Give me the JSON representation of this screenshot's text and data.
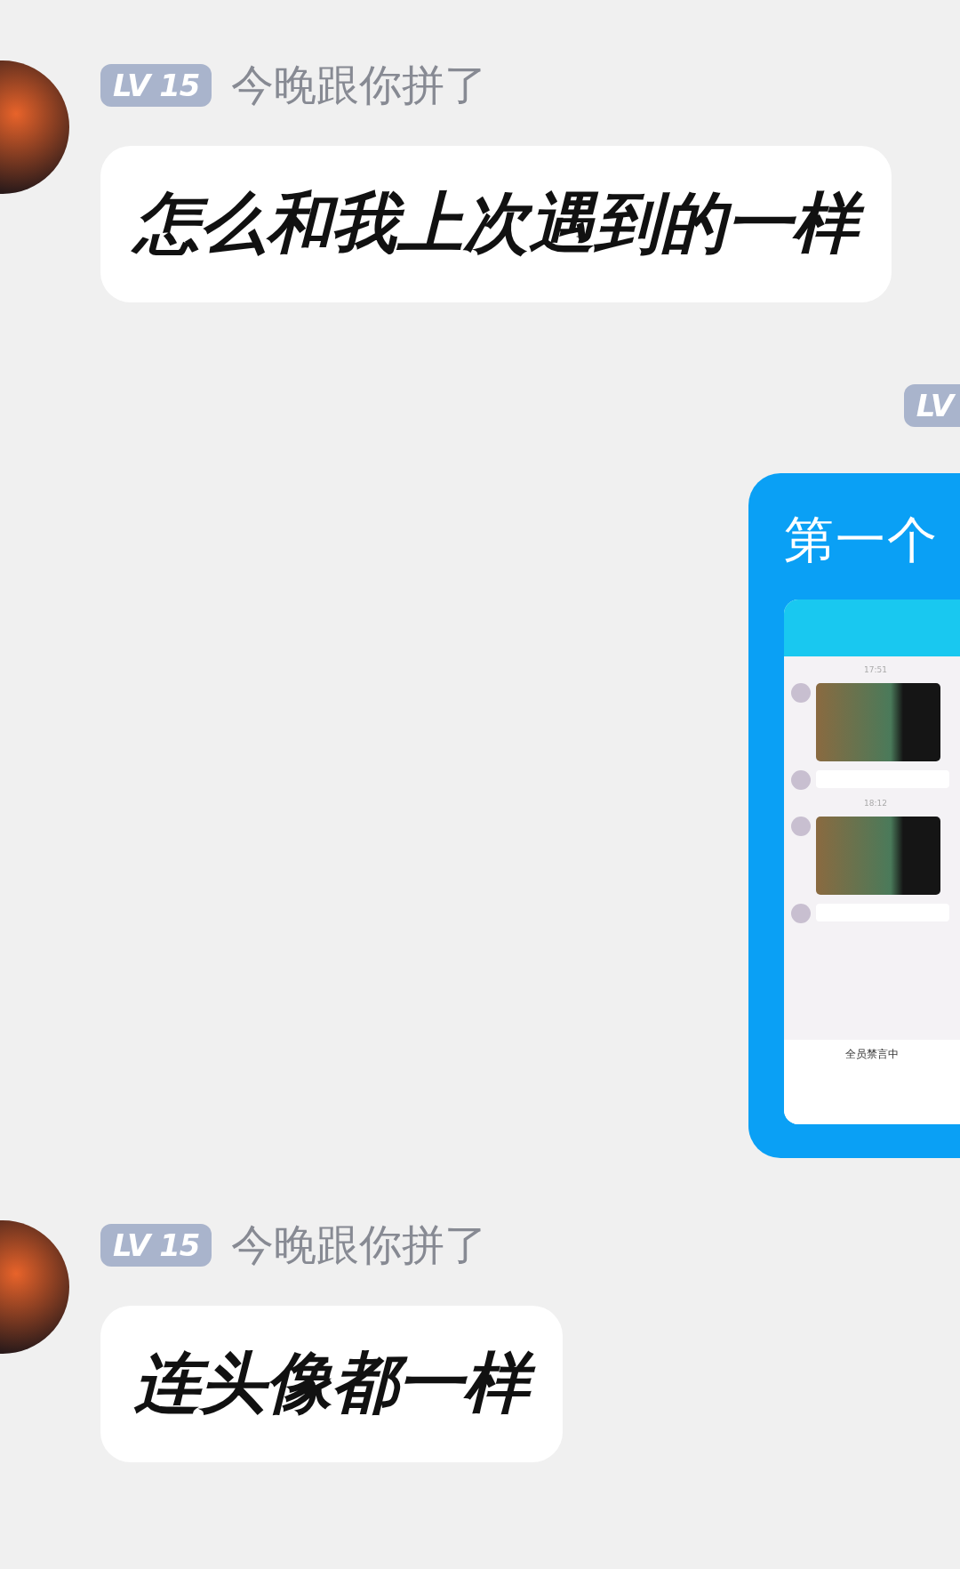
{
  "messages": [
    {
      "kind": "incoming",
      "level_badge": "LV 15",
      "name": "今晚跟你拼了",
      "text": "怎么和我上次遇到的一样"
    },
    {
      "kind": "outgoing",
      "level_badge": "LV",
      "card": {
        "title": "第一个",
        "screenshot": {
          "items": [
            {
              "kind": "time",
              "text": "17:51"
            },
            {
              "kind": "image"
            },
            {
              "kind": "blurred"
            },
            {
              "kind": "time",
              "text": "18:12"
            },
            {
              "kind": "image"
            },
            {
              "kind": "blurred"
            }
          ],
          "notice": "全员禁言中"
        }
      }
    },
    {
      "kind": "incoming",
      "level_badge": "LV 15",
      "name": "今晚跟你拼了",
      "text": "连头像都一样"
    }
  ]
}
